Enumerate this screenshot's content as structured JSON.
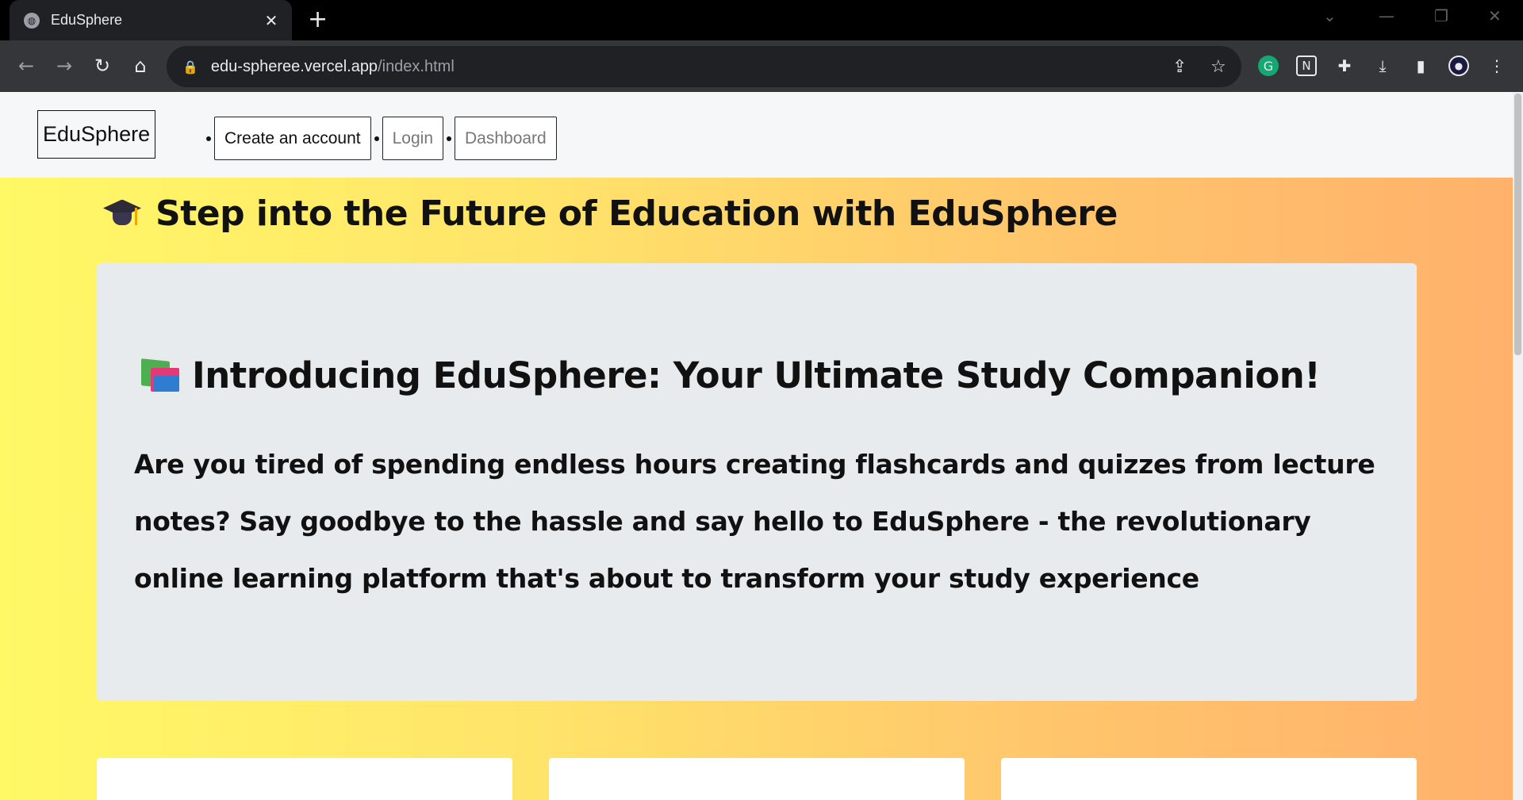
{
  "browser": {
    "tab_title": "EduSphere",
    "url_host": "edu-spheree.vercel.app",
    "url_path": "/index.html"
  },
  "site": {
    "logo": "EduSphere",
    "nav": [
      {
        "label": "Create an account"
      },
      {
        "label": "Login"
      },
      {
        "label": "Dashboard"
      }
    ]
  },
  "hero": {
    "title": "Step into the Future of Education with EduSphere",
    "icon": "graduation-cap-icon"
  },
  "intro": {
    "icon": "books-icon",
    "title": "Introducing EduSphere: Your Ultimate Study Companion!",
    "body": "Are you tired of spending endless hours creating flashcards and quizzes from lecture notes? Say goodbye to the hassle and say hello to EduSphere - the revolutionary online learning platform that's about to transform your study experience"
  },
  "colors": {
    "gradient_start": "#fff966",
    "gradient_end": "#ffb16b",
    "card_bg": "#e8ebee",
    "header_bg": "#f5f7f9"
  }
}
